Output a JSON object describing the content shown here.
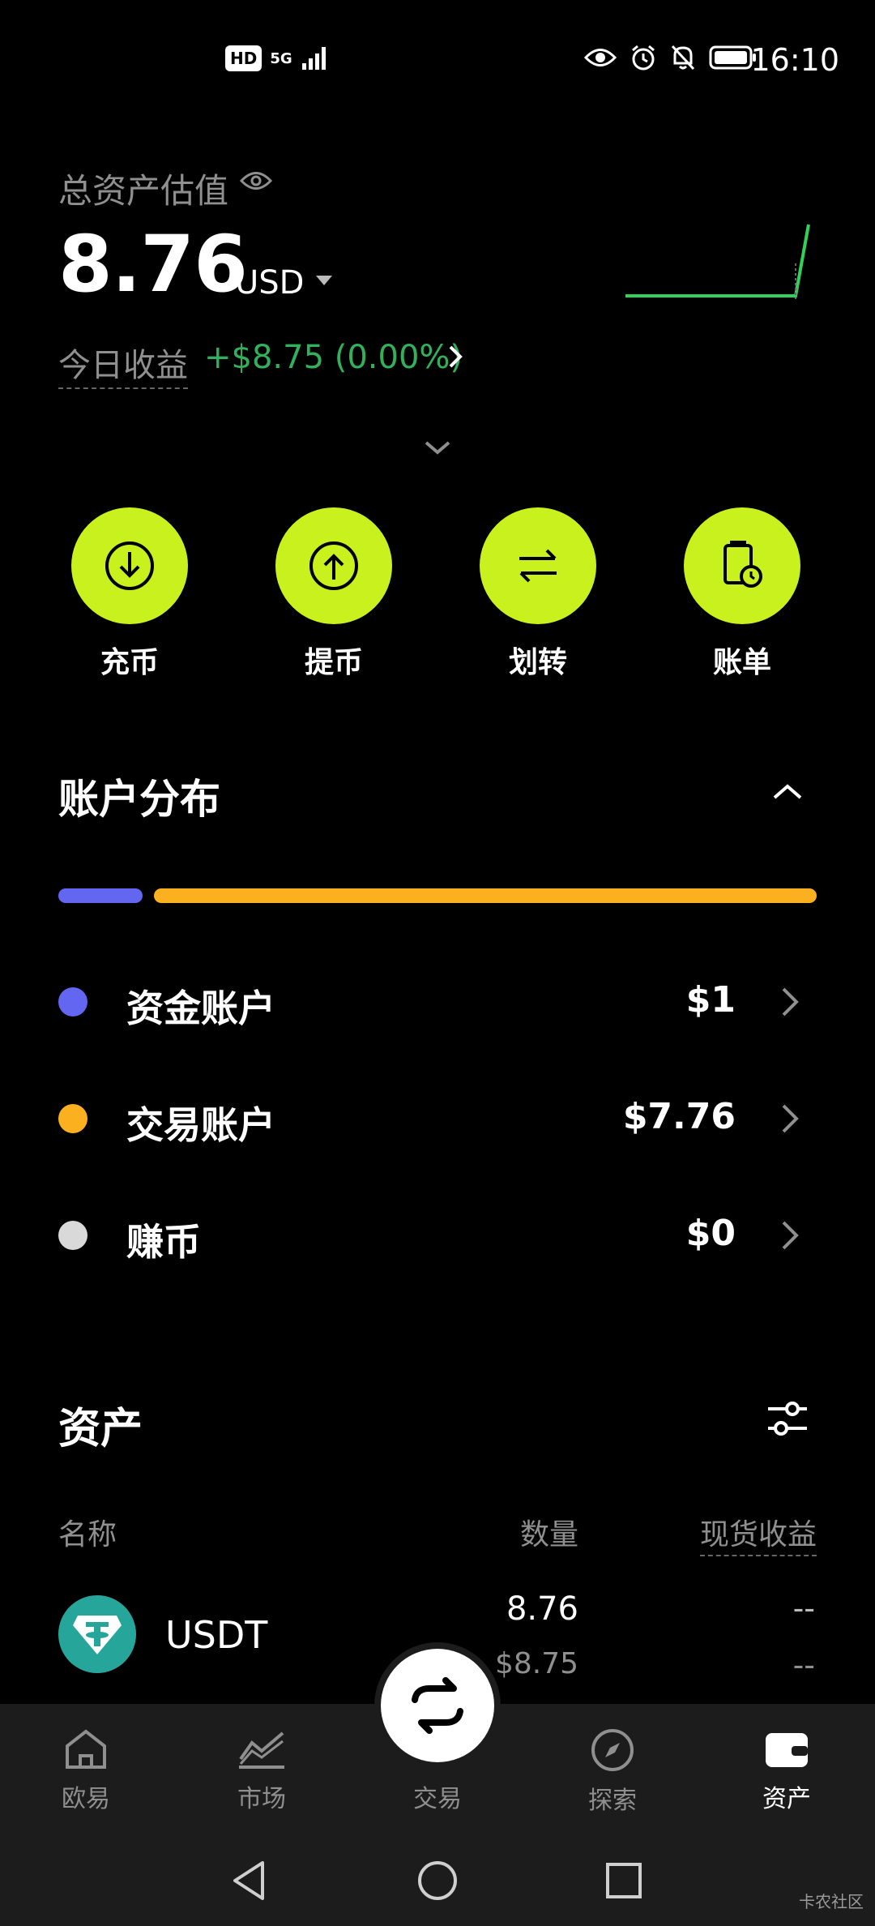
{
  "status_bar": {
    "time": "16:10",
    "hd": "HD",
    "network": "5G"
  },
  "summary": {
    "label": "总资产估值",
    "balance": "8.76",
    "currency": "USD",
    "today_label": "今日收益",
    "today_value": "+$8.75 (0.00%)"
  },
  "actions": [
    {
      "label": "充币",
      "icon": "deposit-icon"
    },
    {
      "label": "提币",
      "icon": "withdraw-icon"
    },
    {
      "label": "划转",
      "icon": "transfer-icon"
    },
    {
      "label": "账单",
      "icon": "bill-icon"
    }
  ],
  "distribution": {
    "title": "账户分布",
    "accounts": [
      {
        "name": "资金账户",
        "value": "$1",
        "color": "#6366f1"
      },
      {
        "name": "交易账户",
        "value": "$7.76",
        "color": "#fbb01f"
      },
      {
        "name": "赚币",
        "value": "$0",
        "color": "#d9d9d9"
      }
    ]
  },
  "assets": {
    "title": "资产",
    "columns": {
      "name": "名称",
      "qty": "数量",
      "pnl": "现货收益"
    },
    "rows": [
      {
        "symbol": "USDT",
        "qty": "8.76",
        "usd": "$8.75",
        "pnl1": "--",
        "pnl2": "--"
      }
    ]
  },
  "bottom_nav": [
    {
      "label": "欧易",
      "icon": "home-icon"
    },
    {
      "label": "市场",
      "icon": "market-icon"
    },
    {
      "label": "交易",
      "icon": "trade-icon"
    },
    {
      "label": "探索",
      "icon": "compass-icon"
    },
    {
      "label": "资产",
      "icon": "wallet-icon"
    }
  ],
  "watermark": "卡农社区",
  "colors": {
    "accent": "#c9f11d",
    "positive": "#31b15c",
    "funding": "#6366f1",
    "trading": "#fbb01f"
  }
}
